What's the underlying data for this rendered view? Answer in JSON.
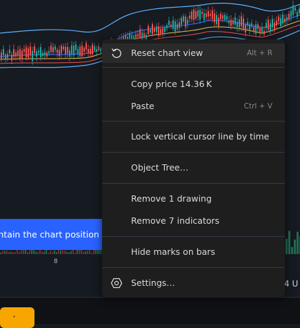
{
  "chart": {
    "toast_text": "intain the chart position",
    "x_tick": "8",
    "x_tick_right": "4 U",
    "colors": {
      "background": "#161a21",
      "up": "#26a69a",
      "down": "#ef5350",
      "band_blue": "#2962ff",
      "band_light": "#5db3ff",
      "toast": "#2962ff",
      "chip": "#f7a600"
    }
  },
  "bottom": {
    "chip_label": "˅"
  },
  "context_menu": {
    "items": [
      {
        "label": "Reset chart view",
        "shortcut": "Alt + R",
        "icon": "reset-icon"
      },
      {
        "label": "Copy price 14.36 K",
        "shortcut": ""
      },
      {
        "label": "Paste",
        "shortcut": "Ctrl + V"
      },
      {
        "label": "Lock vertical cursor line by time",
        "shortcut": ""
      },
      {
        "label": "Object Tree…",
        "shortcut": ""
      },
      {
        "label": "Remove 1 drawing",
        "shortcut": ""
      },
      {
        "label": "Remove 7 indicators",
        "shortcut": ""
      },
      {
        "label": "Hide marks on bars",
        "shortcut": ""
      },
      {
        "label": "Settings…",
        "shortcut": "",
        "icon": "settings-icon"
      }
    ]
  }
}
